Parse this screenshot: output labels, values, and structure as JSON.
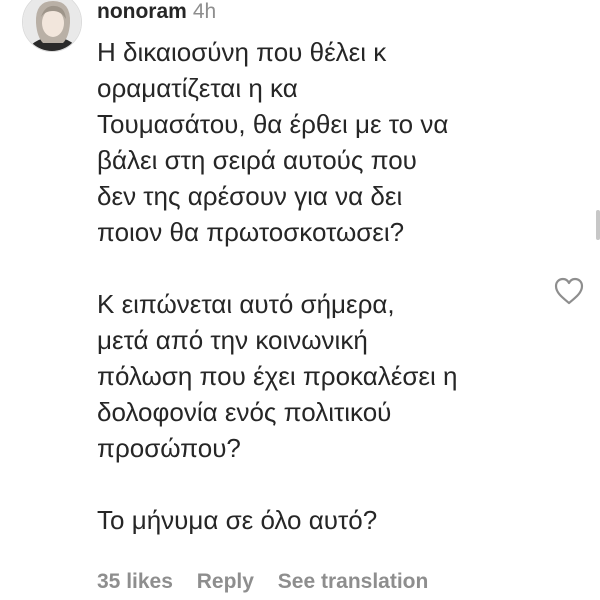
{
  "comment": {
    "username": "nonoram",
    "timestamp": "4h",
    "paragraphs": [
      "Η δικαιοσύνη που θέλει κ\nοραματίζεται η κα\nΤουμασάτου, θα έρθει με το να\nβάλει στη σειρά αυτούς που\nδεν της αρέσουν για να δει\nποιον θα πρωτοσκοτωσει?",
      "Κ ειπώνεται αυτό σήμερα,\nμετά από την κοινωνική\nπόλωση που έχει προκαλέσει η\nδολοφονία ενός πολιτικού\nπροσώπου?",
      "Το μήνυμα σε όλο αυτό?"
    ],
    "likes_label": "35 likes",
    "reply_label": "Reply",
    "translation_label": "See translation"
  },
  "icons": {
    "like": "heart-outline-icon",
    "avatar": "profile-avatar"
  },
  "colors": {
    "text": "#262626",
    "muted": "#8e8e8e"
  }
}
